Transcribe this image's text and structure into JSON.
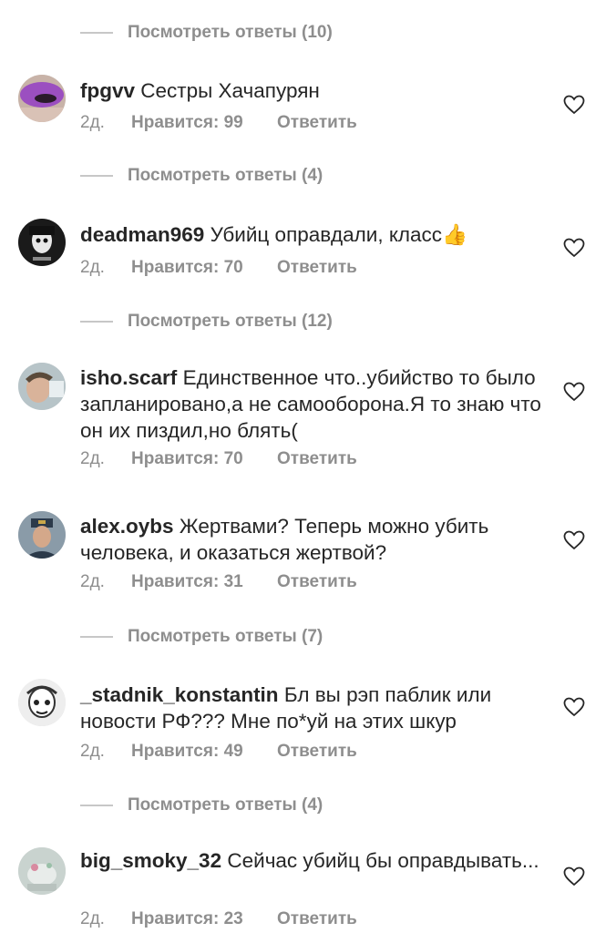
{
  "view_replies": [
    "Посмотреть ответы (10)",
    "Посмотреть ответы (4)",
    "Посмотреть ответы (12)",
    "Посмотреть ответы (7)",
    "Посмотреть ответы (4)"
  ],
  "comments": [
    {
      "username": "fpgvv",
      "text": "Сестры Хачапурян",
      "time": "2д.",
      "likes": "Нравится: 99",
      "reply": "Ответить"
    },
    {
      "username": "deadman969",
      "text": "Убийц оправдали, класс👍",
      "time": "2д.",
      "likes": "Нравится: 70",
      "reply": "Ответить"
    },
    {
      "username": "isho.scarf",
      "text": "Единственное что..убийство то было запланировано,а не самооборона.Я то знаю что он их пиздил,но блять(",
      "time": "2д.",
      "likes": "Нравится: 70",
      "reply": "Ответить"
    },
    {
      "username": "alex.oybs",
      "text": "Жертвами? Теперь можно убить человека, и оказаться жертвой?",
      "time": "2д.",
      "likes": "Нравится: 31",
      "reply": "Ответить"
    },
    {
      "username": "_stadnik_konstantin",
      "text": "Бл вы рэп паблик или новости РФ??? Мне по*уй на этих шкур",
      "time": "2д.",
      "likes": "Нравится: 49",
      "reply": "Ответить"
    },
    {
      "username": "big_smoky_32",
      "text": "Сейчас убийц бы оправдывать...",
      "time": "2д.",
      "likes": "Нравится: 23",
      "reply": "Ответить"
    }
  ],
  "icons": {
    "like": "heart-outline-icon"
  },
  "colors": {
    "text": "#262626",
    "secondary": "#8e8e8e",
    "divider": "#c7c7c7"
  }
}
